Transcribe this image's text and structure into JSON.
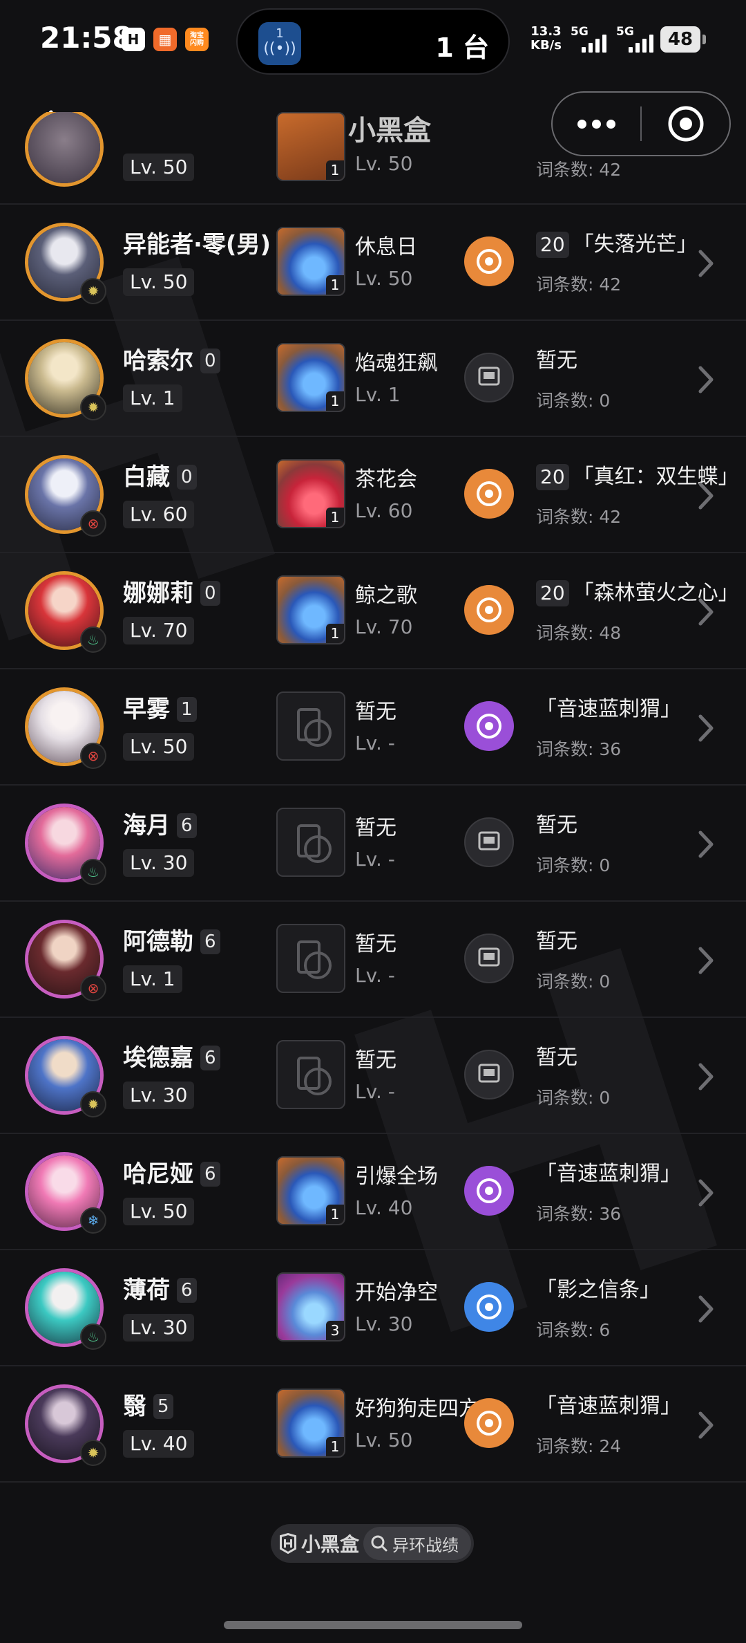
{
  "status_bar": {
    "time": "21:58",
    "island_count": "1",
    "island_label": "1 台",
    "net_speed_value": "13.3",
    "net_speed_unit": "KB/s",
    "signal_1": "5G",
    "signal_2": "5G",
    "battery": "48",
    "app_icon_3": "淘宝\n闪购"
  },
  "nav": {
    "brand": "小黑盒"
  },
  "partial_row": {
    "char_level": "Lv. 50",
    "lc_badge": "1",
    "lc_level": "Lv. 50",
    "relic_count": "词条数: 42"
  },
  "rows": [
    {
      "name": "异能者·零(男)",
      "eidolon": "",
      "level": "Lv. 50",
      "element": "imaginary",
      "avatar_frame": "gold",
      "lc_name": "休息日",
      "lc_level": "Lv. 50",
      "lc_badge": "1",
      "lc_color": "blue",
      "relic_level": "20",
      "relic_name": "「失落光芒」",
      "relic_count": "词条数: 42",
      "relic_color": "#e8893a"
    },
    {
      "name": "哈索尔",
      "eidolon": "0",
      "level": "Lv. 1",
      "element": "imaginary",
      "avatar_frame": "gold",
      "lc_name": "焰魂狂飙",
      "lc_level": "Lv. 1",
      "lc_badge": "1",
      "lc_color": "blue",
      "relic_level": "",
      "relic_name": "暂无",
      "relic_count": "词条数: 0",
      "relic_color": "empty"
    },
    {
      "name": "白藏",
      "eidolon": "0",
      "level": "Lv. 60",
      "element": "fire",
      "avatar_frame": "gold",
      "lc_name": "茶花会",
      "lc_level": "Lv. 60",
      "lc_badge": "1",
      "lc_color": "red",
      "relic_level": "20",
      "relic_name": "「真红：双生蝶」",
      "relic_count": "词条数: 42",
      "relic_color": "#e8893a"
    },
    {
      "name": "娜娜莉",
      "eidolon": "0",
      "level": "Lv. 70",
      "element": "wind",
      "avatar_frame": "gold",
      "lc_name": "鲸之歌",
      "lc_level": "Lv. 70",
      "lc_badge": "1",
      "lc_color": "blue",
      "relic_level": "20",
      "relic_name": "「森林萤火之心」",
      "relic_count": "词条数: 48",
      "relic_color": "#e8893a"
    },
    {
      "name": "早雾",
      "eidolon": "1",
      "level": "Lv. 50",
      "element": "fire",
      "avatar_frame": "gold",
      "lc_name": "暂无",
      "lc_level": "Lv. -",
      "lc_badge": "",
      "lc_color": "empty",
      "relic_level": "",
      "relic_name": "「音速蓝刺猬」",
      "relic_count": "词条数: 36",
      "relic_color": "#9a4fd8"
    },
    {
      "name": "海月",
      "eidolon": "6",
      "level": "Lv. 30",
      "element": "wind",
      "avatar_frame": "purple",
      "lc_name": "暂无",
      "lc_level": "Lv. -",
      "lc_badge": "",
      "lc_color": "empty",
      "relic_level": "",
      "relic_name": "暂无",
      "relic_count": "词条数: 0",
      "relic_color": "empty"
    },
    {
      "name": "阿德勒",
      "eidolon": "6",
      "level": "Lv. 1",
      "element": "fire",
      "avatar_frame": "purple",
      "lc_name": "暂无",
      "lc_level": "Lv. -",
      "lc_badge": "",
      "lc_color": "empty",
      "relic_level": "",
      "relic_name": "暂无",
      "relic_count": "词条数: 0",
      "relic_color": "empty"
    },
    {
      "name": "埃德嘉",
      "eidolon": "6",
      "level": "Lv. 30",
      "element": "imaginary",
      "avatar_frame": "purple",
      "lc_name": "暂无",
      "lc_level": "Lv. -",
      "lc_badge": "",
      "lc_color": "empty",
      "relic_level": "",
      "relic_name": "暂无",
      "relic_count": "词条数: 0",
      "relic_color": "empty"
    },
    {
      "name": "哈尼娅",
      "eidolon": "6",
      "level": "Lv. 50",
      "element": "ice",
      "avatar_frame": "purple",
      "lc_name": "引爆全场",
      "lc_level": "Lv. 40",
      "lc_badge": "1",
      "lc_color": "blue",
      "relic_level": "",
      "relic_name": "「音速蓝刺猬」",
      "relic_count": "词条数: 36",
      "relic_color": "#9a4fd8"
    },
    {
      "name": "薄荷",
      "eidolon": "6",
      "level": "Lv. 30",
      "element": "wind",
      "avatar_frame": "purple",
      "lc_name": "开始净空",
      "lc_level": "Lv. 30",
      "lc_badge": "3",
      "lc_color": "purple",
      "relic_level": "",
      "relic_name": "「影之信条」",
      "relic_count": "词条数: 6",
      "relic_color": "#3f86e6"
    },
    {
      "name": "翳",
      "eidolon": "5",
      "level": "Lv. 40",
      "element": "imaginary",
      "avatar_frame": "purple",
      "lc_name": "好狗狗走四方",
      "lc_level": "Lv. 50",
      "lc_badge": "1",
      "lc_color": "blue",
      "relic_level": "",
      "relic_name": "「音速蓝刺猬」",
      "relic_count": "词条数: 24",
      "relic_color": "#e8893a"
    }
  ],
  "footer": {
    "brand": "小黑盒",
    "tag": "异环战绩"
  }
}
